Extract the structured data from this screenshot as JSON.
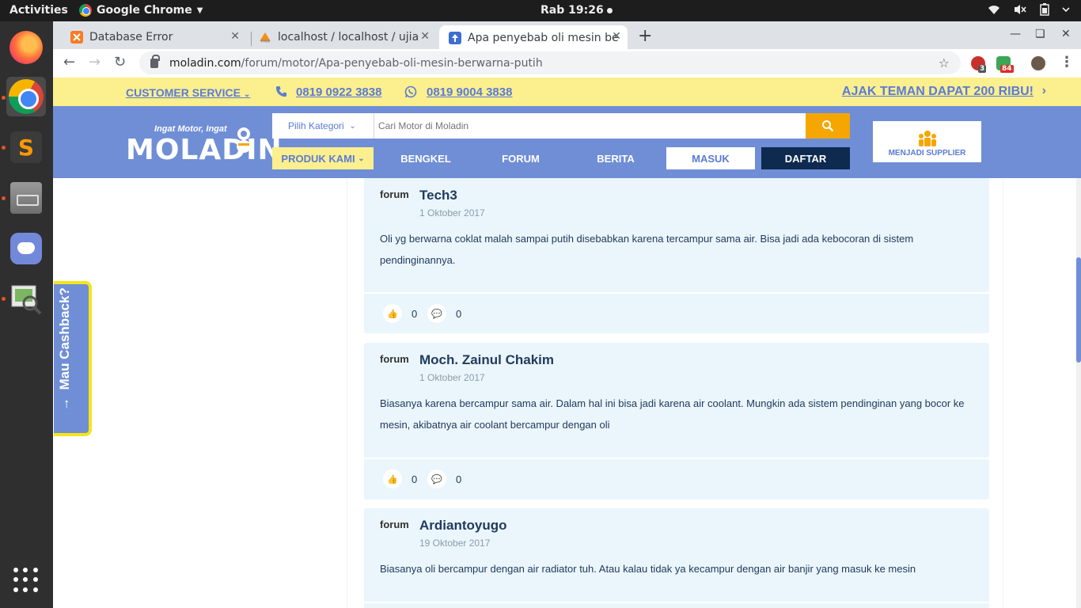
{
  "system": {
    "activities": "Activities",
    "app_menu": "Google Chrome",
    "clock": "Rab 19:26"
  },
  "browser": {
    "tabs": [
      {
        "title": "Database Error",
        "active": false
      },
      {
        "title": "localhost / localhost / ujia",
        "active": false
      },
      {
        "title": "Apa penyebab oli mesin be",
        "active": true
      }
    ],
    "url_host": "moladin.com",
    "url_path": "/forum/motor/Apa-penyebab-oli-mesin-berwarna-putih",
    "ext_badges": [
      "3",
      "84"
    ]
  },
  "topstrip": {
    "customer_service": "CUSTOMER SERVICE",
    "phone1": "0819 0922 3838",
    "phone2": "0819 9004 3838",
    "invite": "AJAK TEMAN DAPAT 200 RIBU!"
  },
  "header": {
    "tagline": "Ingat Motor, Ingat",
    "logo": "MOLADIN",
    "category_label": "Pilih Kategori",
    "search_placeholder": "Cari Motor di Moladin",
    "menu": {
      "produk": "PRODUK KAMI",
      "bengkel": "BENGKEL",
      "forum": "FORUM",
      "berita": "BERITA",
      "masuk": "MASUK",
      "daftar": "DAFTAR"
    },
    "supplier": "MENJADI SUPPLIER"
  },
  "cashback": "Mau Cashback?",
  "avatar_alt": "forum",
  "posts": [
    {
      "author": "Tech3",
      "date": "1 Oktober 2017",
      "body": "Oli yg berwarna coklat malah sampai putih disebabkan karena tercampur sama air. Bisa jadi ada kebocoran di sistem pendinginannya.",
      "likes": "0",
      "comments": "0"
    },
    {
      "author": "Moch. Zainul Chakim",
      "date": "1 Oktober 2017",
      "body": "Biasanya karena bercampur sama air. Dalam hal ini bisa jadi karena air coolant. Mungkin ada sistem pendinginan yang bocor ke mesin, akibatnya air coolant bercampur dengan oli",
      "likes": "0",
      "comments": "0"
    },
    {
      "author": "Ardiantoyugo",
      "date": "19 Oktober 2017",
      "body": "Biasanya oli bercampur dengan air radiator tuh. Atau kalau tidak ya kecampur dengan air banjir yang masuk ke mesin"
    }
  ],
  "colors": {
    "brand_blue": "#6f8ed6",
    "brand_yellow": "#fbef8e",
    "search_button": "#f6a600",
    "daftar_bg": "#0f2a4f",
    "post_bg": "#eaf6fb"
  }
}
